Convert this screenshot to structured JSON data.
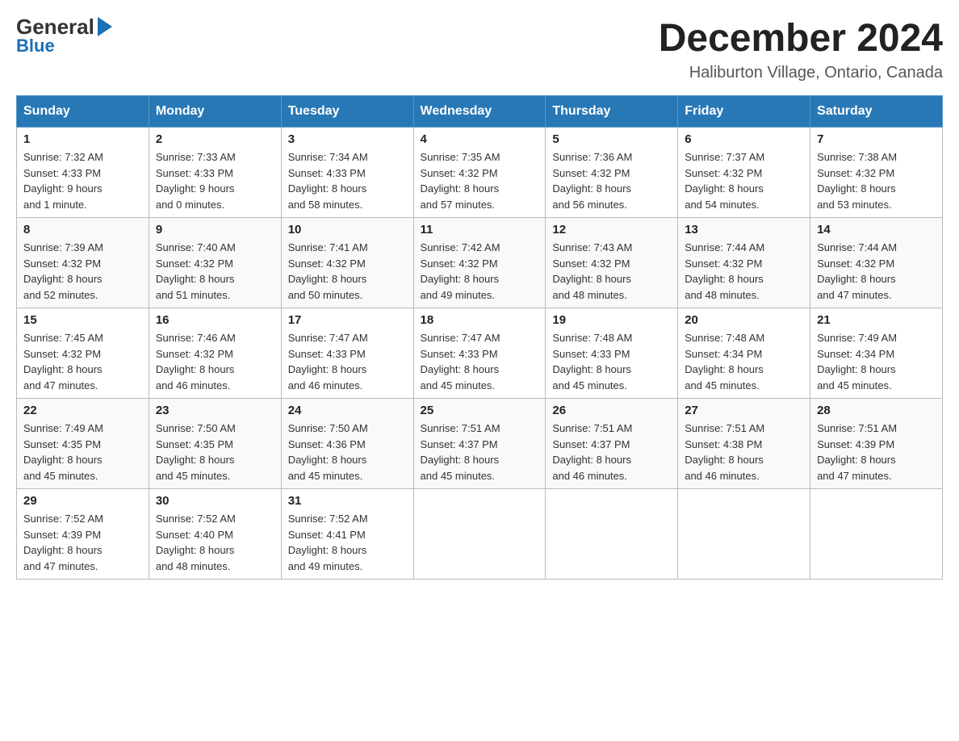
{
  "logo": {
    "line1": "General",
    "line2": "Blue"
  },
  "title": "December 2024",
  "subtitle": "Haliburton Village, Ontario, Canada",
  "days_of_week": [
    "Sunday",
    "Monday",
    "Tuesday",
    "Wednesday",
    "Thursday",
    "Friday",
    "Saturday"
  ],
  "weeks": [
    [
      {
        "day": "1",
        "sunrise": "7:32 AM",
        "sunset": "4:33 PM",
        "daylight": "9 hours and 1 minute."
      },
      {
        "day": "2",
        "sunrise": "7:33 AM",
        "sunset": "4:33 PM",
        "daylight": "9 hours and 0 minutes."
      },
      {
        "day": "3",
        "sunrise": "7:34 AM",
        "sunset": "4:33 PM",
        "daylight": "8 hours and 58 minutes."
      },
      {
        "day": "4",
        "sunrise": "7:35 AM",
        "sunset": "4:32 PM",
        "daylight": "8 hours and 57 minutes."
      },
      {
        "day": "5",
        "sunrise": "7:36 AM",
        "sunset": "4:32 PM",
        "daylight": "8 hours and 56 minutes."
      },
      {
        "day": "6",
        "sunrise": "7:37 AM",
        "sunset": "4:32 PM",
        "daylight": "8 hours and 54 minutes."
      },
      {
        "day": "7",
        "sunrise": "7:38 AM",
        "sunset": "4:32 PM",
        "daylight": "8 hours and 53 minutes."
      }
    ],
    [
      {
        "day": "8",
        "sunrise": "7:39 AM",
        "sunset": "4:32 PM",
        "daylight": "8 hours and 52 minutes."
      },
      {
        "day": "9",
        "sunrise": "7:40 AM",
        "sunset": "4:32 PM",
        "daylight": "8 hours and 51 minutes."
      },
      {
        "day": "10",
        "sunrise": "7:41 AM",
        "sunset": "4:32 PM",
        "daylight": "8 hours and 50 minutes."
      },
      {
        "day": "11",
        "sunrise": "7:42 AM",
        "sunset": "4:32 PM",
        "daylight": "8 hours and 49 minutes."
      },
      {
        "day": "12",
        "sunrise": "7:43 AM",
        "sunset": "4:32 PM",
        "daylight": "8 hours and 48 minutes."
      },
      {
        "day": "13",
        "sunrise": "7:44 AM",
        "sunset": "4:32 PM",
        "daylight": "8 hours and 48 minutes."
      },
      {
        "day": "14",
        "sunrise": "7:44 AM",
        "sunset": "4:32 PM",
        "daylight": "8 hours and 47 minutes."
      }
    ],
    [
      {
        "day": "15",
        "sunrise": "7:45 AM",
        "sunset": "4:32 PM",
        "daylight": "8 hours and 47 minutes."
      },
      {
        "day": "16",
        "sunrise": "7:46 AM",
        "sunset": "4:32 PM",
        "daylight": "8 hours and 46 minutes."
      },
      {
        "day": "17",
        "sunrise": "7:47 AM",
        "sunset": "4:33 PM",
        "daylight": "8 hours and 46 minutes."
      },
      {
        "day": "18",
        "sunrise": "7:47 AM",
        "sunset": "4:33 PM",
        "daylight": "8 hours and 45 minutes."
      },
      {
        "day": "19",
        "sunrise": "7:48 AM",
        "sunset": "4:33 PM",
        "daylight": "8 hours and 45 minutes."
      },
      {
        "day": "20",
        "sunrise": "7:48 AM",
        "sunset": "4:34 PM",
        "daylight": "8 hours and 45 minutes."
      },
      {
        "day": "21",
        "sunrise": "7:49 AM",
        "sunset": "4:34 PM",
        "daylight": "8 hours and 45 minutes."
      }
    ],
    [
      {
        "day": "22",
        "sunrise": "7:49 AM",
        "sunset": "4:35 PM",
        "daylight": "8 hours and 45 minutes."
      },
      {
        "day": "23",
        "sunrise": "7:50 AM",
        "sunset": "4:35 PM",
        "daylight": "8 hours and 45 minutes."
      },
      {
        "day": "24",
        "sunrise": "7:50 AM",
        "sunset": "4:36 PM",
        "daylight": "8 hours and 45 minutes."
      },
      {
        "day": "25",
        "sunrise": "7:51 AM",
        "sunset": "4:37 PM",
        "daylight": "8 hours and 45 minutes."
      },
      {
        "day": "26",
        "sunrise": "7:51 AM",
        "sunset": "4:37 PM",
        "daylight": "8 hours and 46 minutes."
      },
      {
        "day": "27",
        "sunrise": "7:51 AM",
        "sunset": "4:38 PM",
        "daylight": "8 hours and 46 minutes."
      },
      {
        "day": "28",
        "sunrise": "7:51 AM",
        "sunset": "4:39 PM",
        "daylight": "8 hours and 47 minutes."
      }
    ],
    [
      {
        "day": "29",
        "sunrise": "7:52 AM",
        "sunset": "4:39 PM",
        "daylight": "8 hours and 47 minutes."
      },
      {
        "day": "30",
        "sunrise": "7:52 AM",
        "sunset": "4:40 PM",
        "daylight": "8 hours and 48 minutes."
      },
      {
        "day": "31",
        "sunrise": "7:52 AM",
        "sunset": "4:41 PM",
        "daylight": "8 hours and 49 minutes."
      },
      null,
      null,
      null,
      null
    ]
  ],
  "labels": {
    "sunrise": "Sunrise:",
    "sunset": "Sunset:",
    "daylight": "Daylight:"
  }
}
